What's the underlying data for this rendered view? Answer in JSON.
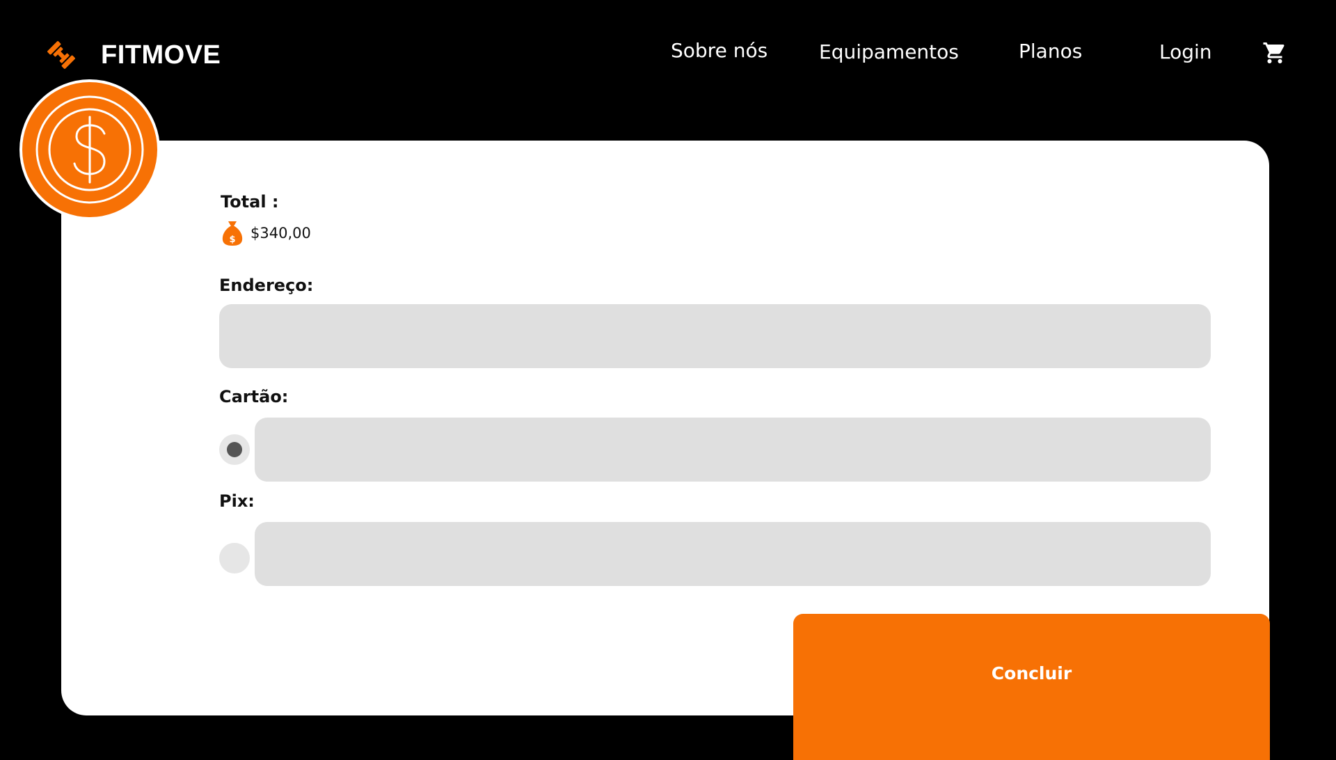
{
  "brand": {
    "name": "FITMOVE",
    "logo_icon": "dumbbell-icon",
    "accent": "#f77105"
  },
  "nav": {
    "items": [
      {
        "label": "Sobre nós"
      },
      {
        "label": "Equipamentos"
      },
      {
        "label": "Planos"
      },
      {
        "label": "Login"
      }
    ],
    "cart_icon": "shopping-cart-icon"
  },
  "checkout": {
    "badge_icon": "dollar-coin-icon",
    "total_label": "Total :",
    "total_icon": "money-bag-icon",
    "total_value": "$340,00",
    "address_label": "Endereço:",
    "address_value": "",
    "card_label": "Cartão:",
    "card_value": "",
    "card_selected": true,
    "pix_label": "Pix:",
    "pix_value": "",
    "pix_selected": false,
    "submit_label": "Concluir"
  }
}
